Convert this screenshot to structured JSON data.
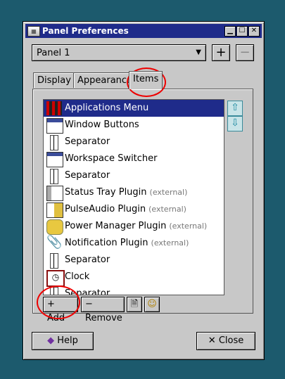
{
  "window": {
    "title": "Panel Preferences",
    "icon": "panel-prefs-icon"
  },
  "title_buttons": {
    "minimize": "▁",
    "maximize": "☐",
    "close": "✕"
  },
  "panel_select": {
    "value": "Panel 1",
    "add_label": "+",
    "remove_label": "−"
  },
  "tabs": [
    {
      "label": "Display"
    },
    {
      "label": "Appearance"
    },
    {
      "label": "Items",
      "active": true
    }
  ],
  "items": [
    {
      "label": "Applications Menu",
      "external": "",
      "icon": "applications-menu-icon",
      "selected": true
    },
    {
      "label": "Window Buttons",
      "external": "",
      "icon": "window-buttons-icon"
    },
    {
      "label": "Separator",
      "external": "",
      "icon": "separator-icon"
    },
    {
      "label": "Workspace Switcher",
      "external": "",
      "icon": "workspace-switcher-icon"
    },
    {
      "label": "Separator",
      "external": "",
      "icon": "separator-icon"
    },
    {
      "label": "Status Tray Plugin",
      "external": "(external)",
      "icon": "status-tray-icon"
    },
    {
      "label": "PulseAudio Plugin",
      "external": "(external)",
      "icon": "pulseaudio-icon"
    },
    {
      "label": "Power Manager Plugin",
      "external": "(external)",
      "icon": "power-manager-icon"
    },
    {
      "label": "Notification Plugin",
      "external": "(external)",
      "icon": "notification-icon"
    },
    {
      "label": "Separator",
      "external": "",
      "icon": "separator-icon"
    },
    {
      "label": "Clock",
      "external": "",
      "icon": "clock-icon"
    },
    {
      "label": "Separator",
      "external": "",
      "icon": "separator-icon"
    }
  ],
  "side_buttons": {
    "up": "⇧",
    "down": "⇩"
  },
  "item_buttons": {
    "add": "+ Add",
    "remove": "− Remove"
  },
  "footer": {
    "help": "Help",
    "close": "Close"
  },
  "colors": {
    "selection": "#1f2b8a",
    "annotation": "#e00000",
    "desktop": "#1c5a6d"
  }
}
